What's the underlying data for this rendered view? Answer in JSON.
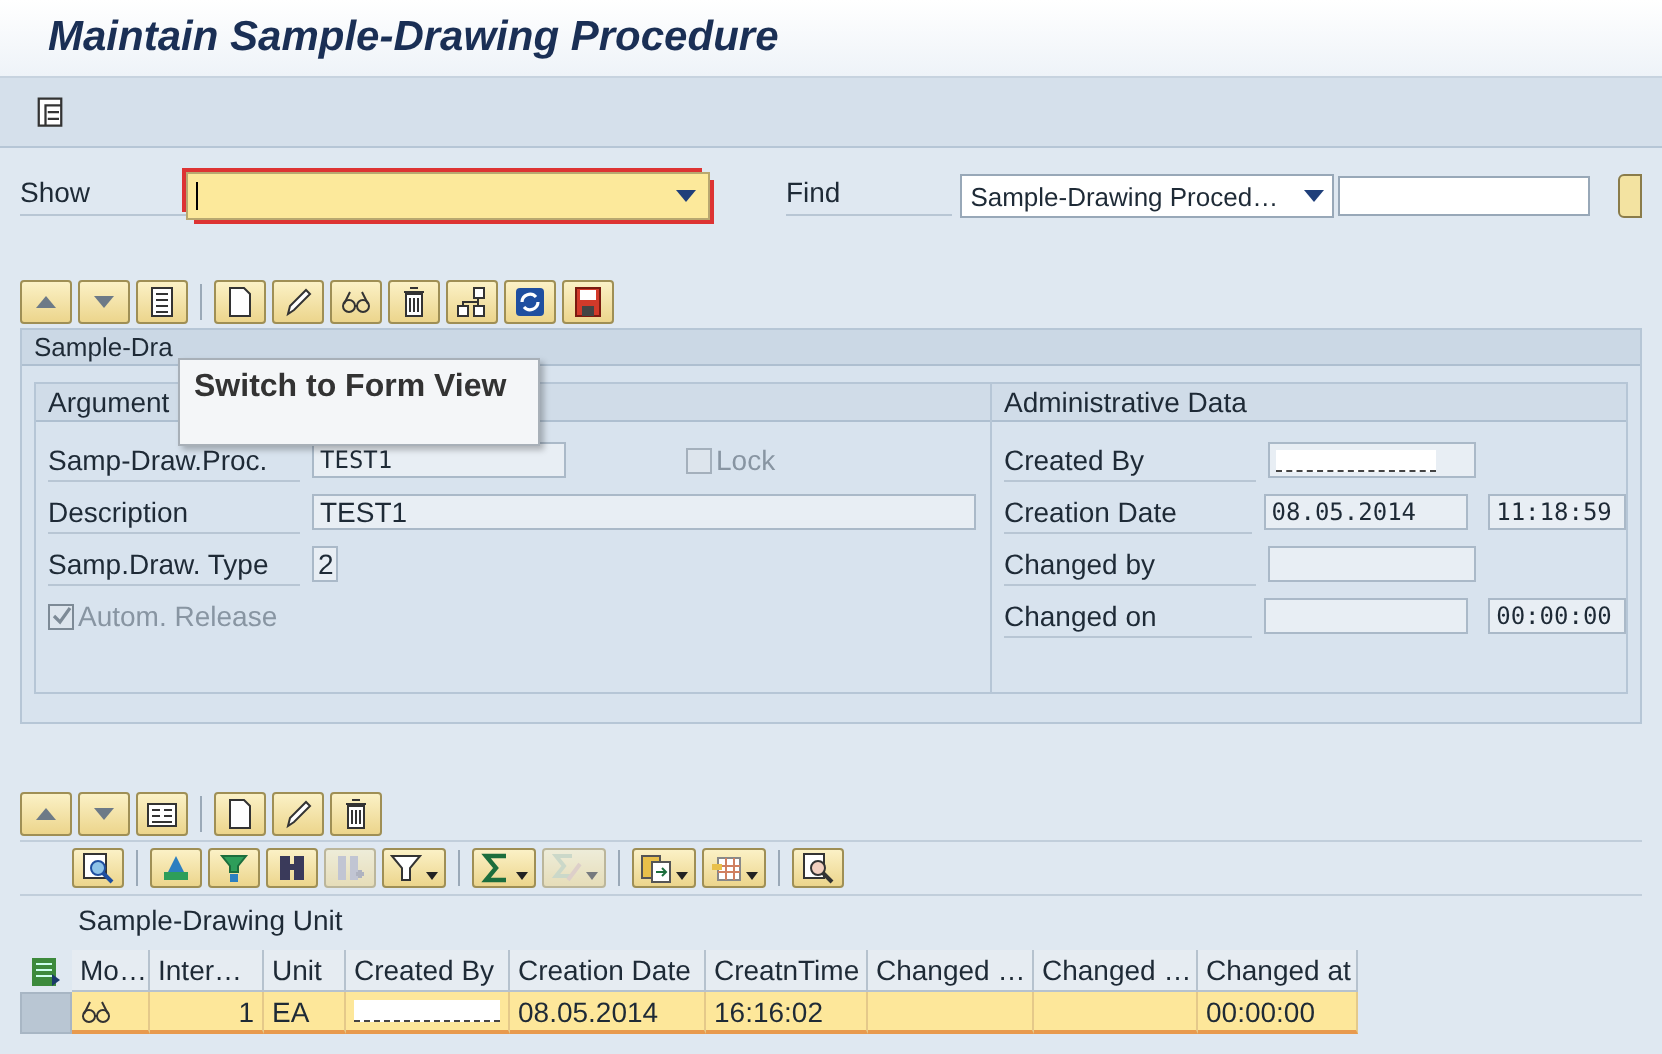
{
  "window": {
    "title": "Maintain Sample-Drawing Procedure"
  },
  "app_toolbar": [
    {
      "kind": "scroll"
    }
  ],
  "selection": {
    "show_label": "Show",
    "find_label": "Find",
    "find_option": "Sample-Drawing Proced…"
  },
  "main_toolbar": [
    [
      {
        "kind": "up"
      },
      {
        "kind": "down"
      },
      {
        "kind": "list"
      }
    ],
    [
      {
        "kind": "page"
      },
      {
        "kind": "pencil"
      },
      {
        "kind": "glasses"
      },
      {
        "kind": "trash"
      },
      {
        "kind": "hierarchy"
      },
      {
        "kind": "refresh"
      },
      {
        "kind": "save"
      }
    ]
  ],
  "tooltip": {
    "text": "Switch to Form View"
  },
  "panel": {
    "title": "Sample-Dra",
    "argument": {
      "title": "Argument",
      "rows": [
        {
          "kind": "code-field",
          "label": "Samp-Draw.Proc.",
          "value": "TEST1",
          "checkbox": {
            "label": "Lock",
            "checked": false,
            "disabled": true
          }
        },
        {
          "kind": "field",
          "label": "Description",
          "value": "TEST1"
        },
        {
          "kind": "field",
          "label": "Samp.Draw. Type",
          "value": "2"
        },
        {
          "kind": "check",
          "label": "Autom. Release",
          "checked": true,
          "disabled": true
        }
      ]
    },
    "admin": {
      "title": "Administrative Data",
      "rows": [
        {
          "label": "Created By",
          "fields": [
            {
              "kind": "redacted"
            }
          ]
        },
        {
          "label": "Creation Date",
          "fields": [
            {
              "kind": "text",
              "value": "08.05.2014"
            },
            {
              "kind": "text",
              "value": "11:18:59"
            }
          ]
        },
        {
          "label": "Changed by",
          "fields": [
            {
              "kind": "empty"
            }
          ]
        },
        {
          "label": "Changed on",
          "fields": [
            {
              "kind": "empty"
            },
            {
              "kind": "text",
              "value": "00:00:00"
            }
          ]
        }
      ]
    }
  },
  "grid_toolbar": [
    [
      {
        "kind": "up"
      },
      {
        "kind": "down"
      },
      {
        "kind": "details"
      }
    ],
    [
      {
        "kind": "page"
      },
      {
        "kind": "pencil"
      },
      {
        "kind": "trash"
      }
    ]
  ],
  "alv_toolbar": [
    [
      {
        "kind": "details-search"
      }
    ],
    [
      {
        "kind": "print"
      },
      {
        "kind": "filter-set"
      },
      {
        "kind": "binoculars"
      },
      {
        "kind": "binoculars-plus",
        "disabled": true
      },
      {
        "kind": "funnel",
        "dropdown": true
      }
    ],
    [
      {
        "kind": "sum",
        "dropdown": true
      },
      {
        "kind": "subtotal",
        "dropdown": true,
        "disabled": true
      }
    ],
    [
      {
        "kind": "export",
        "dropdown": true
      },
      {
        "kind": "layout",
        "dropdown": true
      }
    ],
    [
      {
        "kind": "preview"
      }
    ]
  ],
  "table": {
    "title": "Sample-Drawing Unit",
    "columns": [
      "Mo…",
      "Inter…",
      "Unit",
      "Created By",
      "Creation Date",
      "CreatnTime",
      "Changed …",
      "Changed …",
      "Changed at"
    ],
    "rows": [
      {
        "selected": true,
        "cells": [
          {
            "kind": "icon"
          },
          {
            "kind": "number",
            "text": "1"
          },
          {
            "kind": "text",
            "text": "EA"
          },
          {
            "kind": "redacted"
          },
          {
            "kind": "text",
            "text": "08.05.2014"
          },
          {
            "kind": "text",
            "text": "16:16:02"
          },
          {
            "kind": "empty"
          },
          {
            "kind": "empty"
          },
          {
            "kind": "text",
            "text": "00:00:00"
          }
        ]
      }
    ]
  }
}
